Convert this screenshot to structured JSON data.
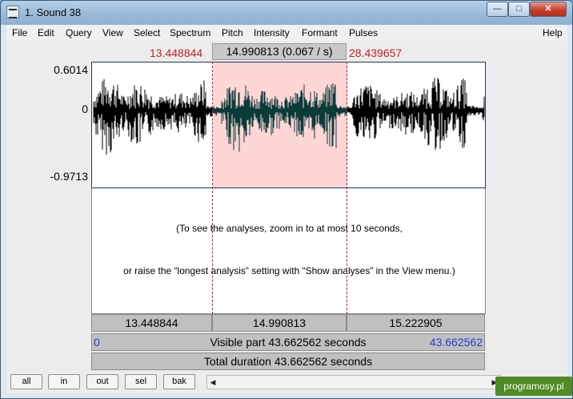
{
  "window": {
    "title": "1. Sound 38"
  },
  "menu": {
    "items": [
      "File",
      "Edit",
      "Query",
      "View",
      "Select",
      "Spectrum",
      "Pitch",
      "Intensity",
      "Formant",
      "Pulses"
    ],
    "help": "Help"
  },
  "selection": {
    "start": "13.448844",
    "end": "28.439657",
    "duration_label": "14.990813 (0.067 / s)"
  },
  "amplitude": {
    "max": "0.6014",
    "zero": "0",
    "min": "-0.9713"
  },
  "analysis_message": {
    "line1": "(To see the analyses, zoom in to at most 10 seconds,",
    "line2": "or raise the “longest analysis” setting with “Show analyses” in the View menu.)"
  },
  "time_bar": {
    "left": "13.448844",
    "middle": "14.990813",
    "right": "15.222905"
  },
  "visible_bar": {
    "start": "0",
    "label": "Visible part 43.662562 seconds",
    "end": "43.662562"
  },
  "total_bar": {
    "label": "Total duration 43.662562 seconds"
  },
  "nav_buttons": {
    "all": "all",
    "in": "in",
    "out": "out",
    "sel": "sel",
    "bak": "bak"
  },
  "watermark": "programosy.pl",
  "colors": {
    "selection_fill": "#ffd6d6",
    "waveform": "#000000",
    "waveform_selected": "#0b3b38",
    "cursor_lines": "#c81f1f",
    "visible_range_text": "#1f3fcc"
  }
}
